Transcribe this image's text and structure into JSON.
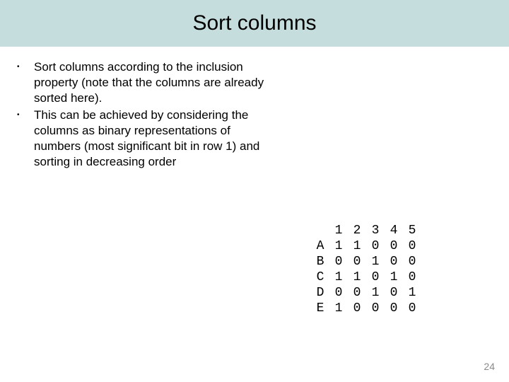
{
  "title": "Sort columns",
  "bullets": [
    "Sort columns according to the inclusion property (note that the columns are already sorted here).",
    "This can be achieved by considering the columns as binary representations of numbers (most significant bit in row 1) and sorting in decreasing order"
  ],
  "chart_data": {
    "type": "table",
    "columns": [
      "1",
      "2",
      "3",
      "4",
      "5"
    ],
    "rows": [
      "A",
      "B",
      "C",
      "D",
      "E"
    ],
    "values": [
      [
        1,
        1,
        0,
        0,
        0
      ],
      [
        0,
        0,
        1,
        0,
        0
      ],
      [
        1,
        1,
        0,
        1,
        0
      ],
      [
        0,
        0,
        1,
        0,
        1
      ],
      [
        1,
        0,
        0,
        0,
        0
      ]
    ]
  },
  "page_number": "24",
  "colors": {
    "title_bg": "#c5dddd",
    "page_number": "#8a8a8a"
  }
}
